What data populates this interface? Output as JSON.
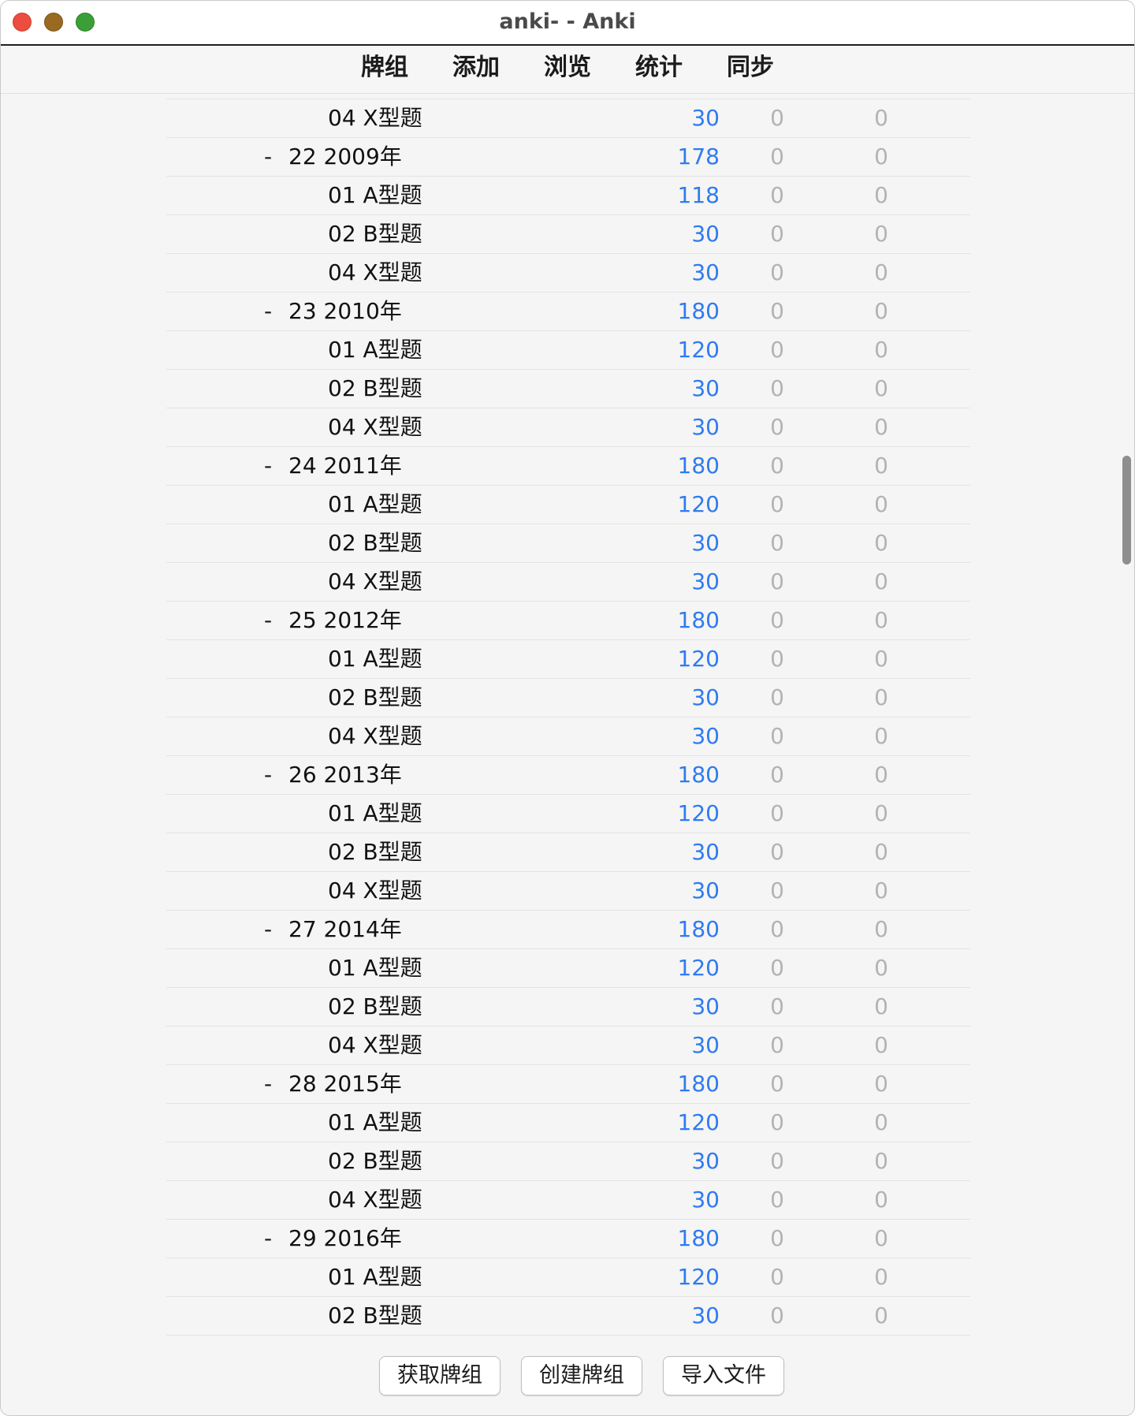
{
  "window": {
    "title": "anki- - Anki"
  },
  "toolbar": {
    "decks": "牌组",
    "add": "添加",
    "browse": "浏览",
    "stats": "统计",
    "sync": "同步"
  },
  "collapse_symbol": "-",
  "colors": {
    "due": "#2f7bf0",
    "zero": "#b3b3b3",
    "text": "#111111"
  },
  "deck_rows": [
    {
      "level": "child",
      "name": "04 X型题",
      "due": "30",
      "new": "0",
      "learn": "0"
    },
    {
      "level": "parent",
      "name": "22 2009年",
      "due": "178",
      "new": "0",
      "learn": "0"
    },
    {
      "level": "child",
      "name": "01 A型题",
      "due": "118",
      "new": "0",
      "learn": "0"
    },
    {
      "level": "child",
      "name": "02 B型题",
      "due": "30",
      "new": "0",
      "learn": "0"
    },
    {
      "level": "child",
      "name": "04 X型题",
      "due": "30",
      "new": "0",
      "learn": "0"
    },
    {
      "level": "parent",
      "name": "23 2010年",
      "due": "180",
      "new": "0",
      "learn": "0"
    },
    {
      "level": "child",
      "name": "01 A型题",
      "due": "120",
      "new": "0",
      "learn": "0"
    },
    {
      "level": "child",
      "name": "02 B型题",
      "due": "30",
      "new": "0",
      "learn": "0"
    },
    {
      "level": "child",
      "name": "04 X型题",
      "due": "30",
      "new": "0",
      "learn": "0"
    },
    {
      "level": "parent",
      "name": "24 2011年",
      "due": "180",
      "new": "0",
      "learn": "0"
    },
    {
      "level": "child",
      "name": "01 A型题",
      "due": "120",
      "new": "0",
      "learn": "0"
    },
    {
      "level": "child",
      "name": "02 B型题",
      "due": "30",
      "new": "0",
      "learn": "0"
    },
    {
      "level": "child",
      "name": "04 X型题",
      "due": "30",
      "new": "0",
      "learn": "0"
    },
    {
      "level": "parent",
      "name": "25 2012年",
      "due": "180",
      "new": "0",
      "learn": "0"
    },
    {
      "level": "child",
      "name": "01 A型题",
      "due": "120",
      "new": "0",
      "learn": "0"
    },
    {
      "level": "child",
      "name": "02 B型题",
      "due": "30",
      "new": "0",
      "learn": "0"
    },
    {
      "level": "child",
      "name": "04 X型题",
      "due": "30",
      "new": "0",
      "learn": "0"
    },
    {
      "level": "parent",
      "name": "26 2013年",
      "due": "180",
      "new": "0",
      "learn": "0"
    },
    {
      "level": "child",
      "name": "01 A型题",
      "due": "120",
      "new": "0",
      "learn": "0"
    },
    {
      "level": "child",
      "name": "02 B型题",
      "due": "30",
      "new": "0",
      "learn": "0"
    },
    {
      "level": "child",
      "name": "04 X型题",
      "due": "30",
      "new": "0",
      "learn": "0"
    },
    {
      "level": "parent",
      "name": "27 2014年",
      "due": "180",
      "new": "0",
      "learn": "0"
    },
    {
      "level": "child",
      "name": "01 A型题",
      "due": "120",
      "new": "0",
      "learn": "0"
    },
    {
      "level": "child",
      "name": "02 B型题",
      "due": "30",
      "new": "0",
      "learn": "0"
    },
    {
      "level": "child",
      "name": "04 X型题",
      "due": "30",
      "new": "0",
      "learn": "0"
    },
    {
      "level": "parent",
      "name": "28 2015年",
      "due": "180",
      "new": "0",
      "learn": "0"
    },
    {
      "level": "child",
      "name": "01 A型题",
      "due": "120",
      "new": "0",
      "learn": "0"
    },
    {
      "level": "child",
      "name": "02 B型题",
      "due": "30",
      "new": "0",
      "learn": "0"
    },
    {
      "level": "child",
      "name": "04 X型题",
      "due": "30",
      "new": "0",
      "learn": "0"
    },
    {
      "level": "parent",
      "name": "29 2016年",
      "due": "180",
      "new": "0",
      "learn": "0"
    },
    {
      "level": "child",
      "name": "01 A型题",
      "due": "120",
      "new": "0",
      "learn": "0"
    },
    {
      "level": "child",
      "name": "02 B型题",
      "due": "30",
      "new": "0",
      "learn": "0"
    }
  ],
  "buttons": {
    "get_shared": "获取牌组",
    "create_deck": "创建牌组",
    "import_file": "导入文件"
  }
}
